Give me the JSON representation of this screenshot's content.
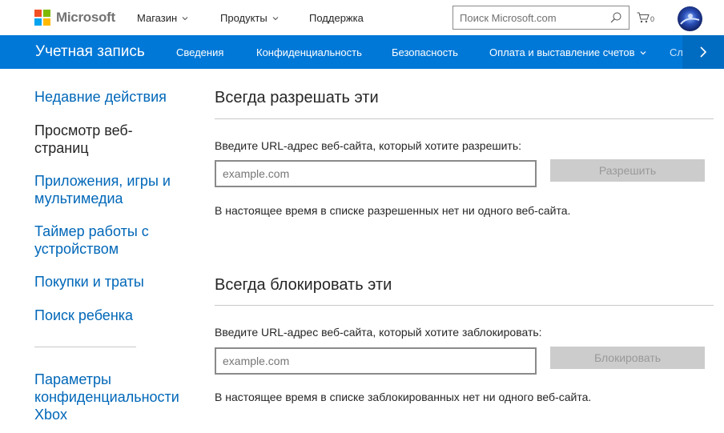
{
  "header": {
    "logo_text": "Microsoft",
    "logo_colors": [
      "#f25022",
      "#7fba00",
      "#00a4ef",
      "#ffb900"
    ],
    "nav": [
      {
        "label": "Магазин",
        "has_dropdown": true
      },
      {
        "label": "Продукты",
        "has_dropdown": true
      },
      {
        "label": "Поддержка",
        "has_dropdown": false
      }
    ],
    "search": {
      "placeholder": "Поиск Microsoft.com",
      "icon": "search-icon"
    },
    "cart": {
      "icon": "cart-icon",
      "count": "0"
    },
    "avatar": {
      "icon": "user-avatar"
    }
  },
  "account_bar": {
    "title": "Учетная запись",
    "links": [
      {
        "label": "Сведения"
      },
      {
        "label": "Конфиденциальность"
      },
      {
        "label": "Безопасность"
      },
      {
        "label": "Оплата и выставление счетов",
        "has_dropdown": true
      }
    ],
    "clipped_link": "Сл",
    "next_icon": "chevron-right-icon",
    "colors": {
      "bar": "#0078d7",
      "next": "#006cc1"
    }
  },
  "sidebar": {
    "items": [
      {
        "label": "Недавние действия",
        "active": false
      },
      {
        "label": "Просмотр веб-страниц",
        "active": true
      },
      {
        "label": "Приложения, игры и мультимедиа",
        "active": false
      },
      {
        "label": "Таймер работы с устройством",
        "active": false
      },
      {
        "label": "Покупки и траты",
        "active": false
      },
      {
        "label": "Поиск ребенка",
        "active": false
      }
    ],
    "privacy_link": "Параметры конфиденциальности Xbox",
    "link_color": "#0067b8"
  },
  "allow_section": {
    "title": "Всегда разрешать эти",
    "prompt": "Введите URL-адрес веб-сайта, который хотите разрешить:",
    "input_value": "",
    "input_placeholder": "example.com",
    "button_label": "Разрешить",
    "status": "В настоящее время в списке разрешенных нет ни одного веб-сайта."
  },
  "block_section": {
    "title": "Всегда блокировать эти",
    "prompt": "Введите URL-адрес веб-сайта, который хотите заблокировать:",
    "input_value": "",
    "input_placeholder": "example.com",
    "button_label": "Блокировать",
    "status": "В настоящее время в списке заблокированных нет ни одного веб-сайта."
  }
}
